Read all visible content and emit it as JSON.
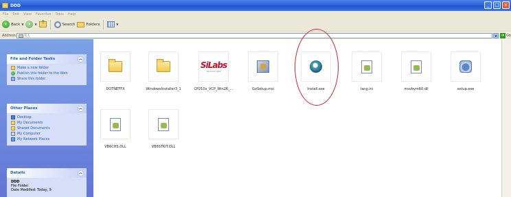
{
  "window": {
    "title": "DDD",
    "buttons": {
      "minimize": "_",
      "maximize": "□",
      "close": "x"
    }
  },
  "menu": [
    "File",
    "Edit",
    "View",
    "Favorites",
    "Tools",
    "Help"
  ],
  "toolbar": {
    "back_label": "Back",
    "search_label": "Search",
    "folders_label": "Folders"
  },
  "address": {
    "label": "Address",
    "value": "C:\\",
    "go_label": "Go"
  },
  "left_pane": {
    "file_tasks": {
      "title": "File and Folder Tasks",
      "items": [
        {
          "label": "Make a new folder",
          "icon": "new-folder-icon"
        },
        {
          "label": "Publish this folder to the Web",
          "icon": "globe-icon"
        },
        {
          "label": "Share this folder",
          "icon": "share-icon"
        }
      ]
    },
    "other_places": {
      "title": "Other Places",
      "items": [
        {
          "label": "Desktop",
          "icon": "desktop-icon"
        },
        {
          "label": "My Documents",
          "icon": "documents-icon"
        },
        {
          "label": "Shared Documents",
          "icon": "shared-documents-icon"
        },
        {
          "label": "My Computer",
          "icon": "computer-icon"
        },
        {
          "label": "My Network Places",
          "icon": "network-icon"
        }
      ]
    },
    "details": {
      "title": "Details",
      "name": "DDD",
      "type": "File Folder",
      "modified": "Date Modified: Today, 5"
    }
  },
  "files": [
    {
      "name": "DOTNETFX",
      "icon": "folder-icon"
    },
    {
      "name": "WindowsInstaller3_1",
      "icon": "folder-icon"
    },
    {
      "name": "CP210x_VCP_Win2K_...",
      "icon": "silabs-logo-icon"
    },
    {
      "name": "GoSetup.msi",
      "icon": "msi-package-icon"
    },
    {
      "name": "Install.exe",
      "icon": "installer-icon"
    },
    {
      "name": "lang.ini",
      "icon": "settings-file-icon"
    },
    {
      "name": "msvbvm60.dll",
      "icon": "dll-file-icon"
    },
    {
      "name": "setup.exe",
      "icon": "setup-icon"
    },
    {
      "name": "VB6CHS.DLL",
      "icon": "dll-file-icon"
    },
    {
      "name": "VB6STKIT.DLL",
      "icon": "dll-file-icon"
    }
  ],
  "highlight": {
    "target": "Install.exe",
    "color": "#d2242a"
  },
  "silabs_text": "SiLabs",
  "silabs_sub": "SILICON LABS"
}
